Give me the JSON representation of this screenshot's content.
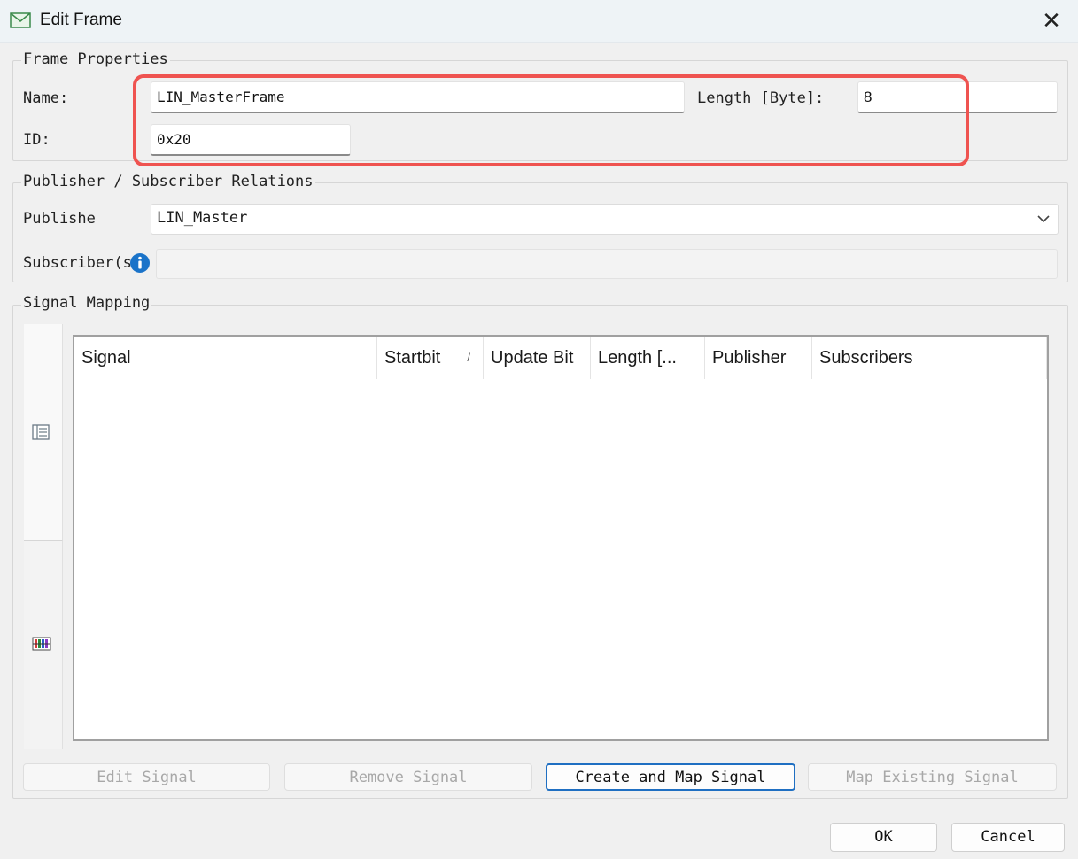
{
  "window": {
    "title": "Edit Frame",
    "close_glyph": "✕"
  },
  "frame_properties": {
    "title": "Frame Properties",
    "name_label": "Name:",
    "name_value": "LIN_MasterFrame",
    "length_label": "Length [Byte]:",
    "length_value": "8",
    "id_label": "ID:",
    "id_value": "0x20"
  },
  "relations": {
    "title": "Publisher / Subscriber Relations",
    "publisher_label": "Publishe",
    "publisher_value": "LIN_Master",
    "subscriber_label": "Subscriber(s",
    "subscriber_value": ""
  },
  "signal_mapping": {
    "title": "Signal Mapping",
    "columns": [
      "Signal",
      "Startbit",
      "Update Bit",
      "Length [...",
      "Publisher",
      "Subscribers"
    ],
    "sort_glyph": "/",
    "rows": []
  },
  "buttons": {
    "edit_signal": "Edit Signal",
    "remove_signal": "Remove Signal",
    "create_map_signal": "Create and Map Signal",
    "map_existing_signal": "Map Existing Signal",
    "ok": "OK",
    "cancel": "Cancel"
  },
  "icons": {
    "title": "envelope-icon",
    "info": "info-icon",
    "dropdown": "chevron-down-icon",
    "side_tab_1": "list-view-icon",
    "side_tab_2": "signal-layout-icon"
  },
  "colors": {
    "highlight": "#ef5350",
    "default_button_border": "#1f6fc2",
    "info": "#1a73c9"
  }
}
